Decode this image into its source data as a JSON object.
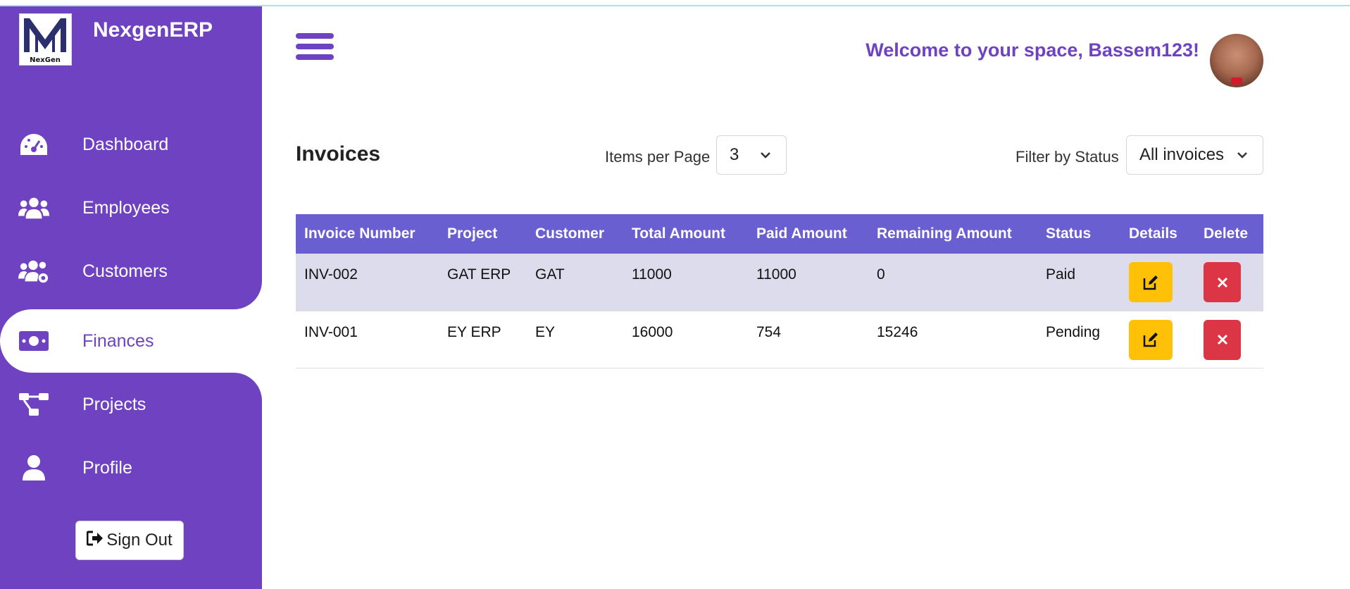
{
  "app": {
    "brand": "NexgenERP",
    "logo_text": "NexGen"
  },
  "sidebar": {
    "items": [
      {
        "label": "Dashboard",
        "icon": "dashboard-gauge-icon"
      },
      {
        "label": "Employees",
        "icon": "users-icon"
      },
      {
        "label": "Customers",
        "icon": "users-cog-icon"
      },
      {
        "label": "Finances",
        "icon": "money-bill-icon",
        "active": true
      },
      {
        "label": "Projects",
        "icon": "project-diagram-icon"
      },
      {
        "label": "Profile",
        "icon": "user-icon"
      }
    ],
    "signout_label": "Sign Out"
  },
  "header": {
    "welcome": "Welcome to your space, Bassem123!"
  },
  "main": {
    "title": "Invoices",
    "items_per_page_label": "Items per Page",
    "items_per_page_value": "3",
    "filter_label": "Filter by Status",
    "filter_value": "All invoices"
  },
  "table": {
    "headers": [
      "Invoice Number",
      "Project",
      "Customer",
      "Total Amount",
      "Paid Amount",
      "Remaining Amount",
      "Status",
      "Details",
      "Delete"
    ],
    "rows": [
      {
        "invoice": "INV-002",
        "project": "GAT ERP",
        "customer": "GAT",
        "total": "11000",
        "paid": "11000",
        "remaining": "0",
        "status": "Paid"
      },
      {
        "invoice": "INV-001",
        "project": "EY ERP",
        "customer": "EY",
        "total": "16000",
        "paid": "754",
        "remaining": "15246",
        "status": "Pending"
      }
    ]
  },
  "colors": {
    "sidebar": "#6f42c1",
    "table_header": "#6a5fd1",
    "row_alt": "#dddcec",
    "edit_button": "#ffc107",
    "delete_button": "#dc3545"
  }
}
